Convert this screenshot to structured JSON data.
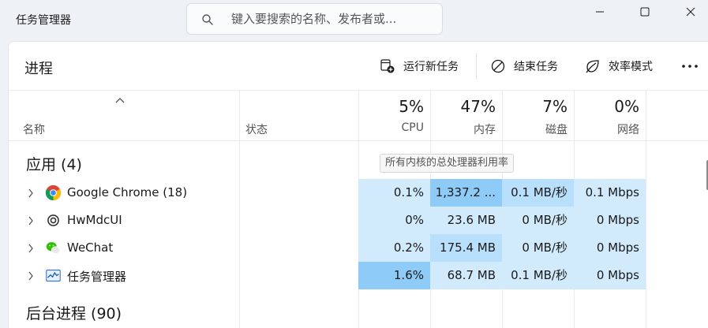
{
  "app": {
    "title": "任务管理器"
  },
  "search": {
    "placeholder": "键入要搜索的名称、发布者或..."
  },
  "toolbar": {
    "page_title": "进程",
    "run_task": "运行新任务",
    "end_task": "结束任务",
    "efficiency": "效率模式",
    "more": "..."
  },
  "columns": {
    "name": "名称",
    "status": "状态",
    "cpu": {
      "percent": "5%",
      "label": "CPU"
    },
    "memory": {
      "percent": "47%",
      "label": "内存"
    },
    "disk": {
      "percent": "7%",
      "label": "磁盘"
    },
    "network": {
      "percent": "0%",
      "label": "网络"
    }
  },
  "tooltip": "所有内核的总处理器利用率",
  "groups": {
    "apps": {
      "title": "应用 (4)"
    },
    "background": {
      "title": "后台进程 (90)"
    }
  },
  "rows": [
    {
      "name": "Google Chrome (18)",
      "icon": "chrome-icon",
      "cpu": "0.1%",
      "memory": "1,337.2 ...",
      "disk": "0.1 MB/秒",
      "network": "0.1 Mbps"
    },
    {
      "name": "HwMdcUI",
      "icon": "hwmdcui-icon",
      "cpu": "0%",
      "memory": "23.6 MB",
      "disk": "0 MB/秒",
      "network": "0 Mbps"
    },
    {
      "name": "WeChat",
      "icon": "wechat-icon",
      "cpu": "0.2%",
      "memory": "175.4 MB",
      "disk": "0 MB/秒",
      "network": "0 Mbps"
    },
    {
      "name": "任务管理器",
      "icon": "task-manager-icon",
      "cpu": "1.6%",
      "memory": "68.7 MB",
      "disk": "0.1 MB/秒",
      "network": "0 Mbps"
    }
  ],
  "colors": {
    "heat_light": "#d1eafc",
    "heat_mid": "#b8dffb",
    "heat_strong": "#8ecbf7"
  }
}
